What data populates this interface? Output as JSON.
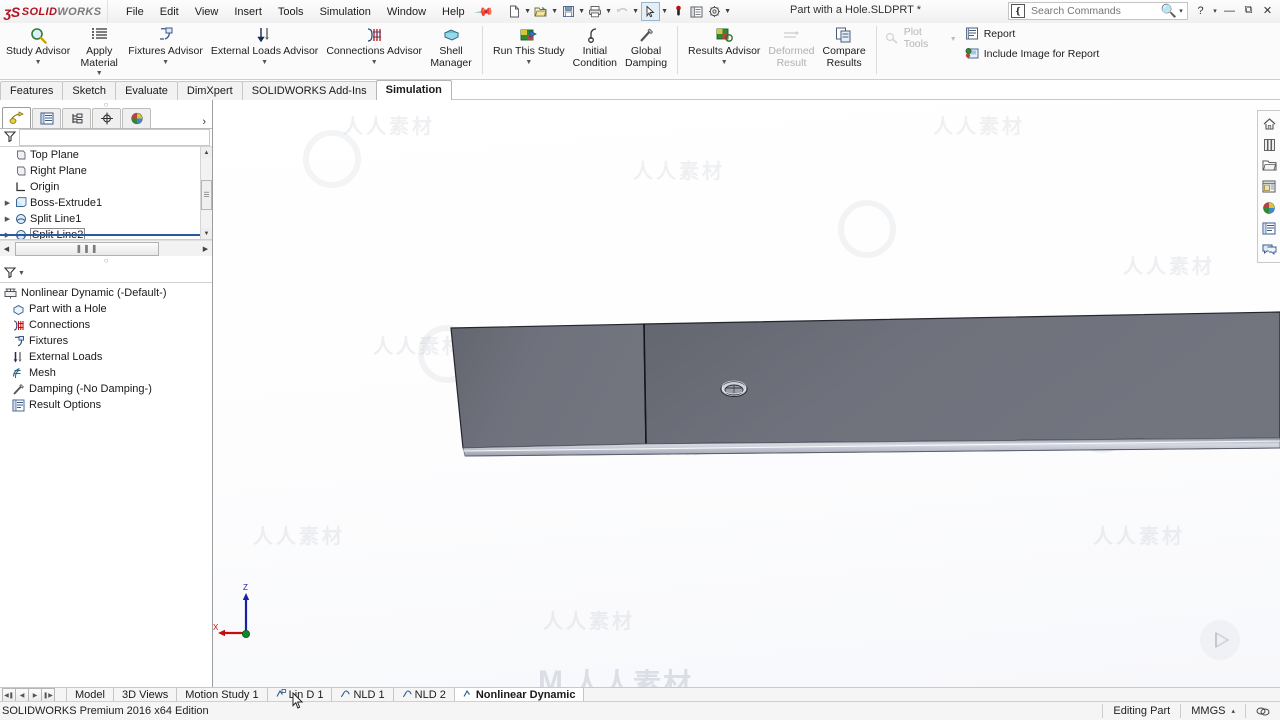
{
  "app": {
    "brand_ds": "ʒS",
    "brand_name_bold": "SOLID",
    "brand_name_light": "WORKS",
    "document_title": "Part with a Hole.SLDPRT *",
    "accent_red": "#b3121f"
  },
  "menu": {
    "items": [
      "File",
      "Edit",
      "View",
      "Insert",
      "Tools",
      "Simulation",
      "Window",
      "Help"
    ],
    "pin_icon": "pushpin-icon"
  },
  "quick_access": {
    "buttons": [
      {
        "name": "new-document",
        "icon": "new-file-icon",
        "dropdown": true
      },
      {
        "name": "open-document",
        "icon": "open-folder-icon",
        "dropdown": true
      },
      {
        "name": "save-document",
        "icon": "save-disk-icon",
        "dropdown": true
      },
      {
        "name": "print-document",
        "icon": "printer-icon",
        "dropdown": true
      },
      {
        "name": "undo",
        "icon": "undo-arrow-icon",
        "dropdown": true,
        "disabled": true
      },
      {
        "name": "select",
        "icon": "select-pointer-icon",
        "dropdown": true,
        "boxed": true
      },
      {
        "name": "rebuild",
        "icon": "rebuild-icon"
      },
      {
        "name": "file-properties",
        "icon": "properties-list-icon"
      },
      {
        "name": "options",
        "icon": "gear-icon",
        "dropdown": true
      }
    ]
  },
  "search": {
    "placeholder": "Search Commands",
    "icon": "search-box-icon",
    "magnifier": "magnifier-icon",
    "dropdown_caret": "▾"
  },
  "window_controls": {
    "help": "?",
    "help_caret": "▾",
    "minimize": "—",
    "restore": "⧉",
    "close": "✕"
  },
  "ribbon": {
    "groups": [
      {
        "name": "advisors",
        "buttons": [
          {
            "label": "Study Advisor",
            "icon": "magnifier-study-icon",
            "dropdown": true,
            "disabled": false
          },
          {
            "label": "Apply\nMaterial",
            "icon": "material-list-icon",
            "dropdown": true,
            "disabled": false
          },
          {
            "label": "Fixtures Advisor",
            "icon": "fixture-icon",
            "dropdown": true,
            "disabled": false
          },
          {
            "label": "External Loads Advisor",
            "icon": "external-loads-icon",
            "dropdown": true,
            "disabled": false
          },
          {
            "label": "Connections Advisor",
            "icon": "connections-icon",
            "dropdown": true,
            "disabled": false
          },
          {
            "label": "Shell\nManager",
            "icon": "shell-manager-icon",
            "dropdown": false,
            "disabled": false
          }
        ]
      },
      {
        "name": "run",
        "buttons": [
          {
            "label": "Run This Study",
            "icon": "run-study-icon",
            "dropdown": true,
            "disabled": false
          },
          {
            "label": "Initial\nCondition",
            "icon": "initial-condition-icon",
            "dropdown": false,
            "disabled": false
          },
          {
            "label": "Global\nDamping",
            "icon": "global-damping-icon",
            "dropdown": false,
            "disabled": false
          }
        ]
      },
      {
        "name": "results",
        "buttons": [
          {
            "label": "Results Advisor",
            "icon": "results-advisor-icon",
            "dropdown": true,
            "disabled": false
          },
          {
            "label": "Deformed\nResult",
            "icon": "deformed-result-icon",
            "dropdown": false,
            "disabled": true
          },
          {
            "label": "Compare\nResults",
            "icon": "compare-results-icon",
            "dropdown": false,
            "disabled": false
          }
        ]
      },
      {
        "name": "report",
        "small_buttons": [
          {
            "label": "Plot Tools",
            "icon": "plot-tools-icon",
            "dropdown": true,
            "disabled": true
          },
          {
            "label": "Report",
            "icon": "report-icon",
            "dropdown": false,
            "disabled": false
          },
          {
            "label": "Include Image for Report",
            "icon": "include-image-icon",
            "dropdown": false,
            "disabled": false
          }
        ]
      }
    ]
  },
  "command_tabs": {
    "items": [
      "Features",
      "Sketch",
      "Evaluate",
      "DimXpert",
      "SOLIDWORKS Add-Ins",
      "Simulation"
    ],
    "active": "Simulation"
  },
  "feature_tree": {
    "tabs": [
      {
        "name": "feature-manager-tab",
        "icon": "feature-tree-icon",
        "active": true
      },
      {
        "name": "property-manager-tab",
        "icon": "property-list-icon",
        "active": false
      },
      {
        "name": "configuration-manager-tab",
        "icon": "configuration-icon",
        "active": false
      },
      {
        "name": "dimxpert-manager-tab",
        "icon": "dimxpert-icon",
        "active": false
      },
      {
        "name": "display-manager-tab",
        "icon": "display-palette-icon",
        "active": false
      }
    ],
    "expand_caret": "›",
    "filter_icon": "filter-funnel-icon",
    "items": [
      {
        "label": "Top Plane",
        "icon": "plane-icon",
        "expandable": false,
        "selected": false
      },
      {
        "label": "Right Plane",
        "icon": "plane-icon",
        "expandable": false,
        "selected": false
      },
      {
        "label": "Origin",
        "icon": "origin-icon",
        "expandable": false,
        "selected": false
      },
      {
        "label": "Boss-Extrude1",
        "icon": "extrude-icon",
        "expandable": true,
        "selected": false
      },
      {
        "label": "Split Line1",
        "icon": "split-line-icon",
        "expandable": true,
        "selected": false
      },
      {
        "label": "Split Line2",
        "icon": "split-line-icon",
        "expandable": true,
        "selected": true
      }
    ],
    "hscroll_thumb_icon": "grip-dots"
  },
  "simulation_tree": {
    "filter_icon": "filter-funnel-icon",
    "items": [
      {
        "label": "Nonlinear Dynamic (-Default-)",
        "icon": "study-icon",
        "indent": false
      },
      {
        "label": "Part with a Hole",
        "icon": "part-solid-icon",
        "indent": true
      },
      {
        "label": "Connections",
        "icon": "connections-icon",
        "indent": true
      },
      {
        "label": "Fixtures",
        "icon": "fixtures-icon",
        "indent": true
      },
      {
        "label": "External Loads",
        "icon": "external-loads-icon",
        "indent": true
      },
      {
        "label": "Mesh",
        "icon": "mesh-icon",
        "indent": true
      },
      {
        "label": "Damping (-No Damping-)",
        "icon": "damping-icon",
        "indent": true
      },
      {
        "label": "Result Options",
        "icon": "result-options-icon",
        "indent": true
      }
    ]
  },
  "view_toolbar": {
    "buttons": [
      {
        "name": "zoom-to-fit-icon",
        "dropdown": false
      },
      {
        "name": "zoom-to-area-icon",
        "dropdown": false
      },
      {
        "name": "previous-view-icon",
        "dropdown": false
      },
      {
        "name": "section-view-icon",
        "dropdown": false
      },
      {
        "name": "view-orientation-icon",
        "dropdown": false
      },
      {
        "name": "display-style-icon",
        "dropdown": true
      },
      {
        "name": "hide-show-items-icon",
        "dropdown": true
      },
      {
        "name": "edit-appearance-icon",
        "dropdown": true
      },
      {
        "name": "apply-scene-icon",
        "dropdown": true
      },
      {
        "name": "view-settings-icon",
        "dropdown": true
      },
      {
        "name": "viewport-layout-icon",
        "dropdown": true
      }
    ]
  },
  "viewport_controls": {
    "buttons": [
      "restore-left-icon",
      "restore-right-icon",
      "minimize-icon",
      "restore-icon",
      "close-icon"
    ]
  },
  "task_pane": {
    "buttons": [
      {
        "name": "solidworks-resources-icon"
      },
      {
        "name": "design-library-icon"
      },
      {
        "name": "file-explorer-icon"
      },
      {
        "name": "view-palette-icon"
      },
      {
        "name": "appearances-scenes-icon"
      },
      {
        "name": "custom-properties-icon"
      },
      {
        "name": "solidworks-forum-icon"
      }
    ]
  },
  "model": {
    "top_face_color": "#6b6d78",
    "right_face_color": "#75777f",
    "edge_color": "#2b2b33",
    "side_band_color": "#b9bcc8",
    "hole_label": "countersunk-hole"
  },
  "triad": {
    "z_label": "Z",
    "x_label": "X",
    "z_color": "#1b1fa8",
    "x_color": "#c01010",
    "y_color": "#0a8a28"
  },
  "document_tabs": {
    "nav_buttons": [
      "first-tab-icon",
      "previous-tab-icon",
      "next-tab-icon",
      "last-tab-icon"
    ],
    "tabs": [
      {
        "label": "Model",
        "icon": "",
        "active": false
      },
      {
        "label": "3D Views",
        "icon": "",
        "active": false
      },
      {
        "label": "Motion Study 1",
        "icon": "",
        "active": false
      },
      {
        "label": "Lin D 1",
        "icon": "study-tab-icon",
        "active": false
      },
      {
        "label": "NLD 1",
        "icon": "study-tab-icon",
        "active": false
      },
      {
        "label": "NLD 2",
        "icon": "study-tab-icon",
        "active": false
      },
      {
        "label": "Nonlinear Dynamic",
        "icon": "study-tab-icon",
        "active": true
      }
    ]
  },
  "status_bar": {
    "left_text": "SOLIDWORKS Premium 2016 x64 Edition",
    "editing_state": "Editing Part",
    "units": "MMGS",
    "units_caret": "▴",
    "right_icon": "overlay-icon"
  },
  "watermarks": {
    "text_cn": "人人素材",
    "letter": "M"
  }
}
